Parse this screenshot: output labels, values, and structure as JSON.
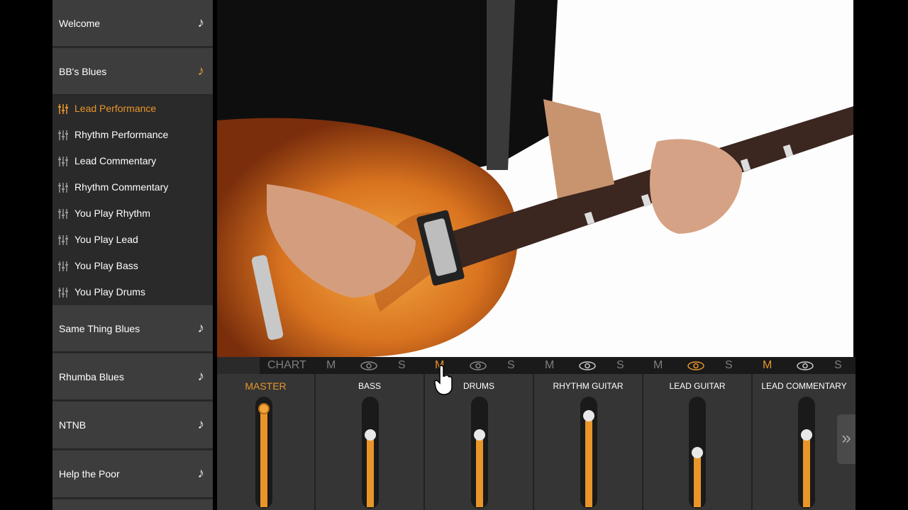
{
  "songs": [
    {
      "label": "Welcome",
      "active": false
    },
    {
      "label": "BB's Blues",
      "active": true
    },
    {
      "label": "Same Thing Blues",
      "active": false
    },
    {
      "label": "Rhumba Blues",
      "active": false
    },
    {
      "label": "NTNB",
      "active": false
    },
    {
      "label": "Help the Poor",
      "active": false
    }
  ],
  "tracks": [
    {
      "label": "Lead Performance",
      "active": true
    },
    {
      "label": "Rhythm Performance",
      "active": false
    },
    {
      "label": "Lead Commentary",
      "active": false
    },
    {
      "label": "Rhythm Commentary",
      "active": false
    },
    {
      "label": "You Play Rhythm",
      "active": false
    },
    {
      "label": "You Play Lead",
      "active": false
    },
    {
      "label": "You Play Bass",
      "active": false
    },
    {
      "label": "You Play Drums",
      "active": false
    }
  ],
  "mixer": {
    "chart_label": "CHART",
    "mute_label": "M",
    "solo_label": "S",
    "channels": [
      {
        "name": "MASTER",
        "level": 0.9
      },
      {
        "name": "BASS",
        "level": 0.66
      },
      {
        "name": "DRUMS",
        "level": 0.66
      },
      {
        "name": "RHYTHM GUITAR",
        "level": 0.84
      },
      {
        "name": "LEAD GUITAR",
        "level": 0.5
      },
      {
        "name": "LEAD COMMENTARY",
        "level": 0.66
      }
    ]
  },
  "colors": {
    "accent": "#e8952a",
    "sidebar_bg": "#2b2b2b",
    "song_bg": "#3d3d3d"
  },
  "icons": {
    "song": "music-note-icon",
    "track": "mixer-sliders-icon",
    "expand": "double-chevron-right-icon",
    "visibility": "eye-icon"
  }
}
